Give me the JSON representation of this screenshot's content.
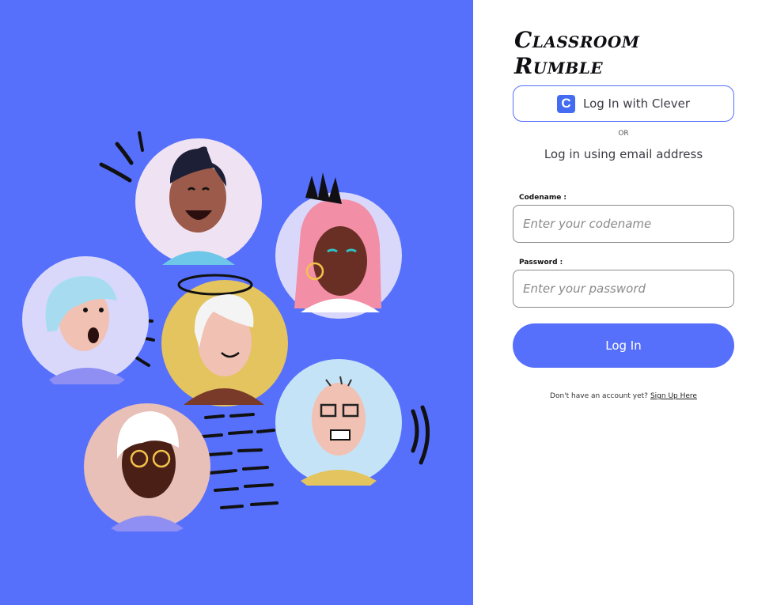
{
  "brand": {
    "logo_text": "Classroom Rumble"
  },
  "auth": {
    "clever_button_label": "Log In with Clever",
    "clever_icon": "clever-c-icon",
    "or_text": "OR",
    "email_heading": "Log in using email address",
    "codename_label": "Codename :",
    "codename_placeholder": "Enter your codename",
    "password_label": "Password :",
    "password_placeholder": "Enter your password",
    "login_button_label": "Log In",
    "signup_prompt": "Don't have an account yet?",
    "signup_link": "Sign Up Here"
  },
  "colors": {
    "accent": "#5670fc",
    "clever_blue": "#436cf2"
  },
  "illustration": {
    "avatars": [
      "smiling-man-avatar",
      "pink-hair-woman-avatar",
      "surprised-woman-avatar",
      "halo-person-avatar",
      "older-woman-avatar",
      "glasses-man-avatar"
    ]
  }
}
